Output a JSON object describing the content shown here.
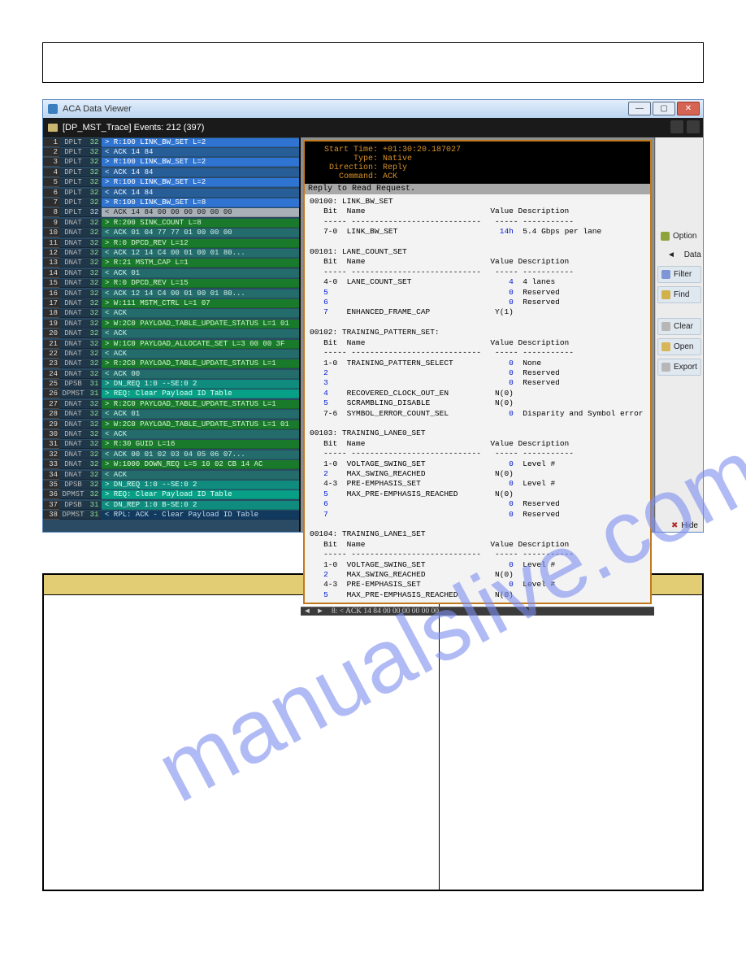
{
  "window": {
    "title": "ACA Data Viewer"
  },
  "toolbar": {
    "label": "[DP_MST_Trace] Events: 212 (397)"
  },
  "side": {
    "option": "Option",
    "data": "Data",
    "filter": "Filter",
    "find": "Find",
    "clear": "Clear",
    "open": "Open",
    "export": "Export",
    "hide": "Hide"
  },
  "decoder": {
    "hdr_start": "    Start Time: +01:30:20.187027",
    "hdr_type": "          Type: Native",
    "hdr_dir": "     Direction: Reply",
    "hdr_cmd": "       Command: ACK",
    "subtitle": "Reply to Read Request.",
    "scroll_msg": "8: < ACK 14 84 00 00 00 00 00 00"
  },
  "events": [
    {
      "n": "1",
      "t": "DPLT",
      "s": "32",
      "cls": "rb-req",
      "txt": "> R:100 LINK_BW_SET L=2"
    },
    {
      "n": "2",
      "t": "DPLT",
      "s": "32",
      "cls": "rb-ack",
      "txt": "< ACK 14 84"
    },
    {
      "n": "3",
      "t": "DPLT",
      "s": "32",
      "cls": "rb-req",
      "txt": "> R:100 LINK_BW_SET L=2"
    },
    {
      "n": "4",
      "t": "DPLT",
      "s": "32",
      "cls": "rb-ack",
      "txt": "< ACK 14 84"
    },
    {
      "n": "5",
      "t": "DPLT",
      "s": "32",
      "cls": "rb-req",
      "txt": "> R:100 LINK_BW_SET L=2"
    },
    {
      "n": "6",
      "t": "DPLT",
      "s": "32",
      "cls": "rb-ack",
      "txt": "< ACK 14 84"
    },
    {
      "n": "7",
      "t": "DPLT",
      "s": "32",
      "cls": "rb-req",
      "txt": "> R:100 LINK_BW_SET L=8"
    },
    {
      "n": "8",
      "t": "DPLT",
      "s": "32",
      "cls": "rb-sel",
      "txt": "< ACK 14 84 00 00 00 00 00 00"
    },
    {
      "n": "9",
      "t": "DNAT",
      "s": "32",
      "cls": "rb-dnat-r",
      "txt": "> R:200 SINK_COUNT L=8"
    },
    {
      "n": "10",
      "t": "DNAT",
      "s": "32",
      "cls": "rb-dnat-w",
      "txt": "< ACK 01 04 77 77 01 00 00 00"
    },
    {
      "n": "11",
      "t": "DNAT",
      "s": "32",
      "cls": "rb-dnat-r",
      "txt": "> R:0 DPCD_REV L=12"
    },
    {
      "n": "12",
      "t": "DNAT",
      "s": "32",
      "cls": "rb-dnat-w",
      "txt": "< ACK 12 14 C4 00 01 00 01 80..."
    },
    {
      "n": "13",
      "t": "DNAT",
      "s": "32",
      "cls": "rb-dnat-r",
      "txt": "> R:21 MSTM_CAP L=1"
    },
    {
      "n": "14",
      "t": "DNAT",
      "s": "32",
      "cls": "rb-dnat-w",
      "txt": "< ACK 01"
    },
    {
      "n": "15",
      "t": "DNAT",
      "s": "32",
      "cls": "rb-dnat-r",
      "txt": "> R:0 DPCD_REV L=15"
    },
    {
      "n": "16",
      "t": "DNAT",
      "s": "32",
      "cls": "rb-dnat-w",
      "txt": "< ACK 12 14 C4 00 01 00 01 80..."
    },
    {
      "n": "17",
      "t": "DNAT",
      "s": "32",
      "cls": "rb-dnat-r",
      "txt": "> W:111 MSTM_CTRL L=1 07"
    },
    {
      "n": "18",
      "t": "DNAT",
      "s": "32",
      "cls": "rb-dnat-w",
      "txt": "< ACK"
    },
    {
      "n": "19",
      "t": "DNAT",
      "s": "32",
      "cls": "rb-dnat-r",
      "txt": "> W:2C0 PAYLOAD_TABLE_UPDATE_STATUS L=1 01"
    },
    {
      "n": "20",
      "t": "DNAT",
      "s": "32",
      "cls": "rb-dnat-w",
      "txt": "< ACK"
    },
    {
      "n": "21",
      "t": "DNAT",
      "s": "32",
      "cls": "rb-dnat-r",
      "txt": "> W:1C0 PAYLOAD_ALLOCATE_SET L=3 00 00 3F"
    },
    {
      "n": "22",
      "t": "DNAT",
      "s": "32",
      "cls": "rb-dnat-w",
      "txt": "< ACK"
    },
    {
      "n": "23",
      "t": "DNAT",
      "s": "32",
      "cls": "rb-dnat-r",
      "txt": "> R:2C0 PAYLOAD_TABLE_UPDATE_STATUS L=1"
    },
    {
      "n": "24",
      "t": "DNAT",
      "s": "32",
      "cls": "rb-dnat-w",
      "txt": "< ACK 00"
    },
    {
      "n": "25",
      "t": "DPSB",
      "s": "31",
      "cls": "rb-dpsb",
      "txt": "> DN_REQ 1:0 --SE:0 2"
    },
    {
      "n": "26",
      "t": "DPMST",
      "s": "31",
      "cls": "rb-dpmst-r",
      "txt": "> REQ: Clear Payload ID Table"
    },
    {
      "n": "27",
      "t": "DNAT",
      "s": "32",
      "cls": "rb-dnat-r",
      "txt": "> R:2C0 PAYLOAD_TABLE_UPDATE_STATUS L=1"
    },
    {
      "n": "28",
      "t": "DNAT",
      "s": "32",
      "cls": "rb-dnat-w",
      "txt": "< ACK 01"
    },
    {
      "n": "29",
      "t": "DNAT",
      "s": "32",
      "cls": "rb-dnat-r",
      "txt": "> W:2C0 PAYLOAD_TABLE_UPDATE_STATUS L=1 01"
    },
    {
      "n": "30",
      "t": "DNAT",
      "s": "32",
      "cls": "rb-dnat-w",
      "txt": "< ACK"
    },
    {
      "n": "31",
      "t": "DNAT",
      "s": "32",
      "cls": "rb-dnat-r",
      "txt": "> R:30 GUID L=16"
    },
    {
      "n": "32",
      "t": "DNAT",
      "s": "32",
      "cls": "rb-dnat-w",
      "txt": "< ACK 00 01 02 03 04 05 06 07..."
    },
    {
      "n": "33",
      "t": "DNAT",
      "s": "32",
      "cls": "rb-dnat-r",
      "txt": "> W:1000 DOWN_REQ L=5 10 02 CB 14 AC"
    },
    {
      "n": "34",
      "t": "DNAT",
      "s": "32",
      "cls": "rb-dnat-w",
      "txt": "< ACK"
    },
    {
      "n": "35",
      "t": "DPSB",
      "s": "32",
      "cls": "rb-dpsb",
      "txt": "> DN_REQ 1:0 --SE:0 2"
    },
    {
      "n": "36",
      "t": "DPMST",
      "s": "32",
      "cls": "rb-dpmst-r",
      "txt": "> REQ: Clear Payload ID Table"
    },
    {
      "n": "37",
      "t": "DPSB",
      "s": "31",
      "cls": "rb-dpsb",
      "txt": "< DN_REP 1:0 B-SE:0 2"
    },
    {
      "n": "38",
      "t": "DPMST",
      "s": "31",
      "cls": "rb-dpmst",
      "txt": "< RPL: ACK - Clear Payload ID Table"
    }
  ],
  "regtext": "00100: LINK_BW_SET\n   Bit  Name                           Value Description\n   ----- ----------------------------   ----- -----------\n   7-0  LINK_BW_SET                      14h  5.4 Gbps per lane\n\n00101: LANE_COUNT_SET\n   Bit  Name                           Value Description\n   ----- ----------------------------   ----- -----------\n   4-0  LANE_COUNT_SET                     4  4 lanes\n   5                                       0  Reserved\n   6                                       0  Reserved\n   7    ENHANCED_FRAME_CAP              Y(1)\n\n00102: TRAINING_PATTERN_SET:\n   Bit  Name                           Value Description\n   ----- ----------------------------   ----- -----------\n   1-0  TRAINING_PATTERN_SELECT            0  None\n   2                                       0  Reserved\n   3                                       0  Reserved\n   4    RECOVERED_CLOCK_OUT_EN          N(0)\n   5    SCRAMBLING_DISABLE              N(0)\n   7-6  SYMBOL_ERROR_COUNT_SEL             0  Disparity and Symbol error\n\n00103: TRAINING_LANE0_SET\n   Bit  Name                           Value Description\n   ----- ----------------------------   ----- -----------\n   1-0  VOLTAGE_SWING_SET                  0  Level #\n   2    MAX_SWING_REACHED               N(0)\n   4-3  PRE-EMPHASIS_SET                   0  Level #\n   5    MAX_PRE-EMPHASIS_REACHED        N(0)\n   6                                       0  Reserved\n   7                                       0  Reserved\n\n00104: TRAINING_LANE1_SET\n   Bit  Name                           Value Description\n   ----- ----------------------------   ----- -----------\n   1-0  VOLTAGE_SWING_SET                  0  Level #\n   2    MAX_SWING_REACHED               N(0)\n   4-3  PRE-EMPHASIS_SET                   0  Level #\n   5    MAX_PRE-EMPHASIS_REACHED        N(0)"
}
